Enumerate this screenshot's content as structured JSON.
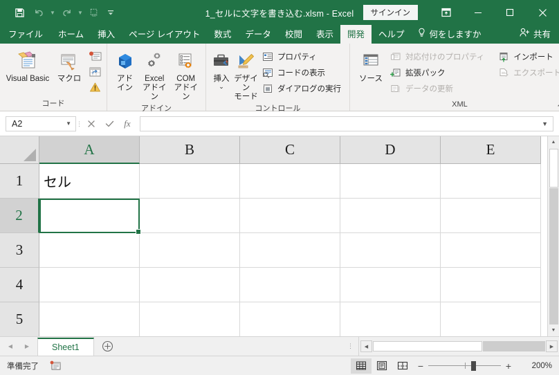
{
  "titlebar": {
    "document_title": "1_セルに文字を書き込む.xlsm  -  Excel",
    "signin_label": "サインイン",
    "quick_access": [
      {
        "name": "save-icon",
        "label": "保存"
      },
      {
        "name": "undo-icon",
        "label": "元に戻す"
      },
      {
        "name": "redo-icon",
        "label": "やり直し"
      },
      {
        "name": "autofill-icon",
        "label": "オートフィル"
      },
      {
        "name": "customize-qat-icon",
        "label": "クイックアクセスツールバーのユーザー設定"
      }
    ],
    "window_controls": {
      "ribbon_display": "リボンの表示オプション",
      "minimize": "最小化",
      "maximize": "最大化",
      "close": "閉じる"
    }
  },
  "tabs": [
    {
      "label": "ファイル",
      "active": false
    },
    {
      "label": "ホーム",
      "active": false
    },
    {
      "label": "挿入",
      "active": false
    },
    {
      "label": "ページ レイアウト",
      "active": false
    },
    {
      "label": "数式",
      "active": false
    },
    {
      "label": "データ",
      "active": false
    },
    {
      "label": "校閲",
      "active": false
    },
    {
      "label": "表示",
      "active": false
    },
    {
      "label": "開発",
      "active": true
    },
    {
      "label": "ヘルプ",
      "active": false
    }
  ],
  "tellme": {
    "label": "何をしますか",
    "icon": "lightbulb-icon"
  },
  "share": {
    "label": "共有",
    "icon": "person-add-icon"
  },
  "ribbon": {
    "groups": [
      {
        "name": "code",
        "label": "コード",
        "big_buttons": [
          {
            "label": "Visual Basic",
            "icon": "visual-basic-icon"
          },
          {
            "label": "マクロ",
            "icon": "macro-icon"
          }
        ],
        "small_icons": [
          {
            "name": "record-macro-icon",
            "label": "マクロの記録"
          },
          {
            "name": "relative-reference-icon",
            "label": "相対参照で記録"
          },
          {
            "name": "macro-security-icon",
            "label": "マクロのセキュリティ"
          }
        ]
      },
      {
        "name": "addins",
        "label": "アドイン",
        "big_buttons": [
          {
            "label": "アド\nイン",
            "line1": "アド",
            "line2": "イン",
            "icon": "addin-icon"
          },
          {
            "label": "Excel\nアドイン",
            "line1": "Excel",
            "line2": "アドイン",
            "icon": "excel-addin-icon"
          },
          {
            "label": "COM\nアドイン",
            "line1": "COM",
            "line2": "アドイン",
            "icon": "com-addin-icon"
          }
        ]
      },
      {
        "name": "controls",
        "label": "コントロール",
        "big_buttons": [
          {
            "line1": "挿入",
            "line2": "⌄",
            "icon": "insert-control-icon"
          },
          {
            "line1": "デザイン",
            "line2": "モード",
            "icon": "design-mode-icon"
          }
        ],
        "small_buttons": [
          {
            "label": "プロパティ",
            "icon": "properties-icon",
            "disabled": false
          },
          {
            "label": "コードの表示",
            "icon": "view-code-icon",
            "disabled": false
          },
          {
            "label": "ダイアログの実行",
            "icon": "run-dialog-icon",
            "disabled": false
          }
        ]
      },
      {
        "name": "xml",
        "label": "XML",
        "big_buttons": [
          {
            "line1": "ソース",
            "line2": "",
            "icon": "xml-source-icon"
          }
        ],
        "small_buttons_col1": [
          {
            "label": "対応付けのプロパティ",
            "icon": "map-properties-icon",
            "disabled": true
          },
          {
            "label": "拡張パック",
            "icon": "expansion-pack-icon",
            "disabled": false
          },
          {
            "label": "データの更新",
            "icon": "refresh-data-icon",
            "disabled": true
          }
        ],
        "small_buttons_col2": [
          {
            "label": "インポート",
            "icon": "import-icon",
            "disabled": false
          },
          {
            "label": "エクスポート",
            "icon": "export-icon",
            "disabled": true
          }
        ]
      }
    ],
    "collapse_label": "リボンを折りたたむ"
  },
  "formula_bar": {
    "name_box_value": "A2",
    "cancel_icon": "cancel-icon",
    "enter_icon": "enter-icon",
    "fx_icon": "fx-icon",
    "formula_value": "",
    "expand_icon": "expand-formula-bar-icon"
  },
  "grid": {
    "columns": [
      "A",
      "B",
      "C",
      "D",
      "E"
    ],
    "selected_column": "A",
    "rows": [
      "1",
      "2",
      "3",
      "4",
      "5"
    ],
    "selected_row": "2",
    "active_cell": "A2",
    "cell_values": [
      [
        "セル",
        "",
        "",
        "",
        ""
      ],
      [
        "",
        "",
        "",
        "",
        ""
      ],
      [
        "",
        "",
        "",
        "",
        ""
      ],
      [
        "",
        "",
        "",
        "",
        ""
      ],
      [
        "",
        "",
        "",
        "",
        ""
      ]
    ]
  },
  "sheet_bar": {
    "prev_icon": "prev-sheet-icon",
    "next_icon": "next-sheet-icon",
    "tabs": [
      {
        "label": "Sheet1",
        "active": true
      }
    ],
    "add_sheet_icon": "add-sheet-icon"
  },
  "status_bar": {
    "status_text": "準備完了",
    "macro_record_icon": "record-macro-status-icon",
    "views": [
      {
        "name": "normal-view-button",
        "label": "標準",
        "active": true
      },
      {
        "name": "page-layout-view-button",
        "label": "ページ レイアウト",
        "active": false
      },
      {
        "name": "page-break-view-button",
        "label": "改ページ プレビュー",
        "active": false
      }
    ],
    "zoom_out_label": "−",
    "zoom_in_label": "+",
    "zoom_level": "200%"
  },
  "colors": {
    "excel_green": "#217346",
    "ribbon_bg": "#f3f2f1",
    "header_bg": "#e4e4e4",
    "selection_green": "#217346"
  }
}
